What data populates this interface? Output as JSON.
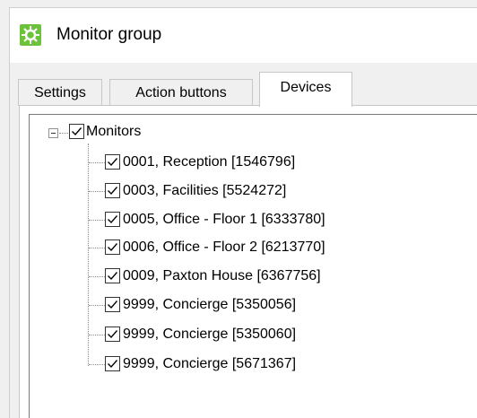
{
  "window": {
    "title": "Monitor group"
  },
  "tabs": [
    "Settings",
    "Action buttons",
    "Devices"
  ],
  "active_tab": "Devices",
  "tree": {
    "root": {
      "label": "Monitors",
      "checked": true,
      "expanded": true
    },
    "children": [
      {
        "label": "0001, Reception [1546796]",
        "checked": true
      },
      {
        "label": "0003, Facilities [5524272]",
        "checked": true
      },
      {
        "label": "0005, Office - Floor 1 [6333780]",
        "checked": true
      },
      {
        "label": "0006, Office - Floor 2 [6213770]",
        "checked": true
      },
      {
        "label": "0009, Paxton House [6367756]",
        "checked": true
      },
      {
        "label": "9999, Concierge [5350056]",
        "checked": true
      },
      {
        "label": "9999, Concierge [5350060]",
        "checked": true
      },
      {
        "label": "9999, Concierge [5671367]",
        "checked": true
      }
    ]
  },
  "colors": {
    "title_icon": "#6dc23b",
    "tree_border": "#7a7a7a"
  },
  "icons": {
    "title": "monitor-group-app-icon",
    "checkbox": "checkmark-icon",
    "expander": "collapse-minus-icon"
  }
}
